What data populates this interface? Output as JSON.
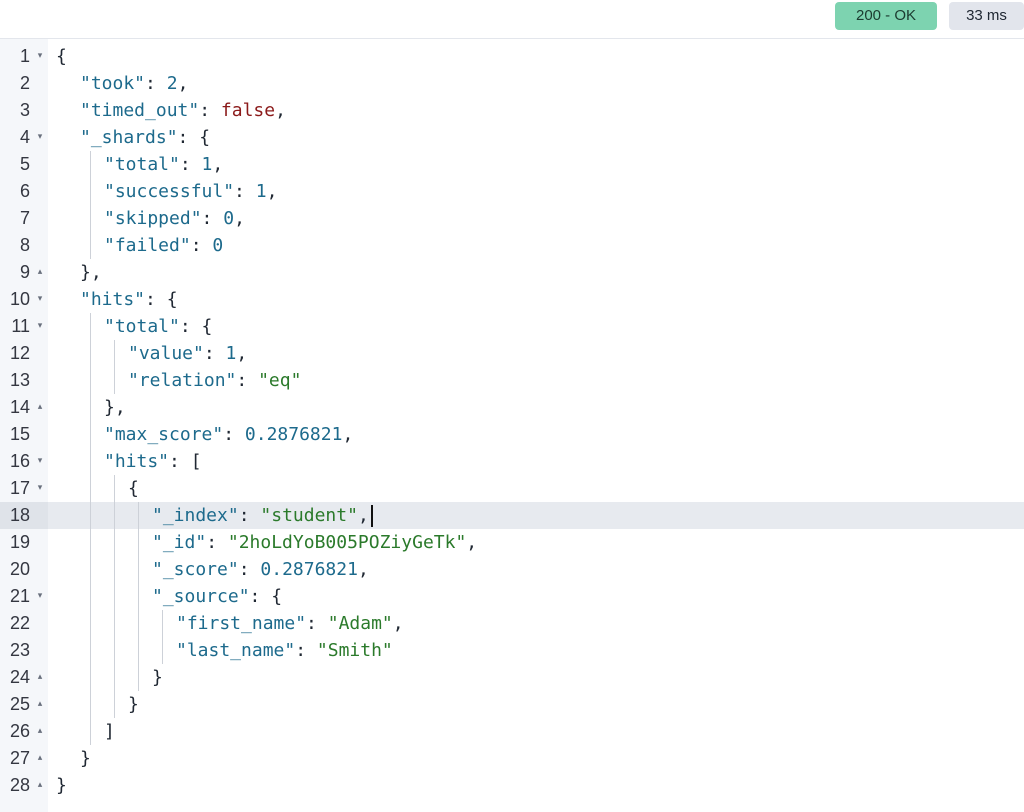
{
  "status": {
    "code_label": "200 - OK",
    "time_label": "33 ms"
  },
  "editor": {
    "active_line": 18,
    "lines": [
      {
        "n": "1",
        "fold": "open",
        "depth": 0,
        "tokens": [
          [
            "punc",
            "{"
          ]
        ]
      },
      {
        "n": "2",
        "depth": 1,
        "tokens": [
          [
            "key",
            "\"took\""
          ],
          [
            "punc",
            ": "
          ],
          [
            "num",
            "2"
          ],
          [
            "punc",
            ","
          ]
        ]
      },
      {
        "n": "3",
        "depth": 1,
        "tokens": [
          [
            "key",
            "\"timed_out\""
          ],
          [
            "punc",
            ": "
          ],
          [
            "bool",
            "false"
          ],
          [
            "punc",
            ","
          ]
        ]
      },
      {
        "n": "4",
        "fold": "open",
        "depth": 1,
        "tokens": [
          [
            "key",
            "\"_shards\""
          ],
          [
            "punc",
            ": {"
          ]
        ]
      },
      {
        "n": "5",
        "depth": 2,
        "tokens": [
          [
            "key",
            "\"total\""
          ],
          [
            "punc",
            ": "
          ],
          [
            "num",
            "1"
          ],
          [
            "punc",
            ","
          ]
        ]
      },
      {
        "n": "6",
        "depth": 2,
        "tokens": [
          [
            "key",
            "\"successful\""
          ],
          [
            "punc",
            ": "
          ],
          [
            "num",
            "1"
          ],
          [
            "punc",
            ","
          ]
        ]
      },
      {
        "n": "7",
        "depth": 2,
        "tokens": [
          [
            "key",
            "\"skipped\""
          ],
          [
            "punc",
            ": "
          ],
          [
            "num",
            "0"
          ],
          [
            "punc",
            ","
          ]
        ]
      },
      {
        "n": "8",
        "depth": 2,
        "tokens": [
          [
            "key",
            "\"failed\""
          ],
          [
            "punc",
            ": "
          ],
          [
            "num",
            "0"
          ]
        ]
      },
      {
        "n": "9",
        "fold": "close",
        "depth": 1,
        "tokens": [
          [
            "punc",
            "},"
          ]
        ]
      },
      {
        "n": "10",
        "fold": "open",
        "depth": 1,
        "tokens": [
          [
            "key",
            "\"hits\""
          ],
          [
            "punc",
            ": {"
          ]
        ]
      },
      {
        "n": "11",
        "fold": "open",
        "depth": 2,
        "tokens": [
          [
            "key",
            "\"total\""
          ],
          [
            "punc",
            ": {"
          ]
        ]
      },
      {
        "n": "12",
        "depth": 3,
        "tokens": [
          [
            "key",
            "\"value\""
          ],
          [
            "punc",
            ": "
          ],
          [
            "num",
            "1"
          ],
          [
            "punc",
            ","
          ]
        ]
      },
      {
        "n": "13",
        "depth": 3,
        "tokens": [
          [
            "key",
            "\"relation\""
          ],
          [
            "punc",
            ": "
          ],
          [
            "str",
            "\"eq\""
          ]
        ]
      },
      {
        "n": "14",
        "fold": "close",
        "depth": 2,
        "tokens": [
          [
            "punc",
            "},"
          ]
        ]
      },
      {
        "n": "15",
        "depth": 2,
        "tokens": [
          [
            "key",
            "\"max_score\""
          ],
          [
            "punc",
            ": "
          ],
          [
            "num",
            "0.2876821"
          ],
          [
            "punc",
            ","
          ]
        ]
      },
      {
        "n": "16",
        "fold": "open",
        "depth": 2,
        "tokens": [
          [
            "key",
            "\"hits\""
          ],
          [
            "punc",
            ": ["
          ]
        ]
      },
      {
        "n": "17",
        "fold": "open",
        "depth": 3,
        "tokens": [
          [
            "punc",
            "{"
          ]
        ]
      },
      {
        "n": "18",
        "depth": 4,
        "tokens": [
          [
            "key",
            "\"_index\""
          ],
          [
            "punc",
            ": "
          ],
          [
            "str",
            "\"student\""
          ],
          [
            "punc",
            ","
          ]
        ]
      },
      {
        "n": "19",
        "depth": 4,
        "tokens": [
          [
            "key",
            "\"_id\""
          ],
          [
            "punc",
            ": "
          ],
          [
            "str",
            "\"2hoLdYoB005POZiyGeTk\""
          ],
          [
            "punc",
            ","
          ]
        ]
      },
      {
        "n": "20",
        "depth": 4,
        "tokens": [
          [
            "key",
            "\"_score\""
          ],
          [
            "punc",
            ": "
          ],
          [
            "num",
            "0.2876821"
          ],
          [
            "punc",
            ","
          ]
        ]
      },
      {
        "n": "21",
        "fold": "open",
        "depth": 4,
        "tokens": [
          [
            "key",
            "\"_source\""
          ],
          [
            "punc",
            ": {"
          ]
        ]
      },
      {
        "n": "22",
        "depth": 5,
        "tokens": [
          [
            "key",
            "\"first_name\""
          ],
          [
            "punc",
            ": "
          ],
          [
            "str",
            "\"Adam\""
          ],
          [
            "punc",
            ","
          ]
        ]
      },
      {
        "n": "23",
        "depth": 5,
        "tokens": [
          [
            "key",
            "\"last_name\""
          ],
          [
            "punc",
            ": "
          ],
          [
            "str",
            "\"Smith\""
          ]
        ]
      },
      {
        "n": "24",
        "fold": "close",
        "depth": 4,
        "tokens": [
          [
            "punc",
            "}"
          ]
        ]
      },
      {
        "n": "25",
        "fold": "close",
        "depth": 3,
        "tokens": [
          [
            "punc",
            "}"
          ]
        ]
      },
      {
        "n": "26",
        "fold": "close",
        "depth": 2,
        "tokens": [
          [
            "punc",
            "]"
          ]
        ]
      },
      {
        "n": "27",
        "fold": "close",
        "depth": 1,
        "tokens": [
          [
            "punc",
            "}"
          ]
        ]
      },
      {
        "n": "28",
        "fold": "close",
        "depth": 0,
        "tokens": [
          [
            "punc",
            "}"
          ]
        ]
      }
    ]
  }
}
